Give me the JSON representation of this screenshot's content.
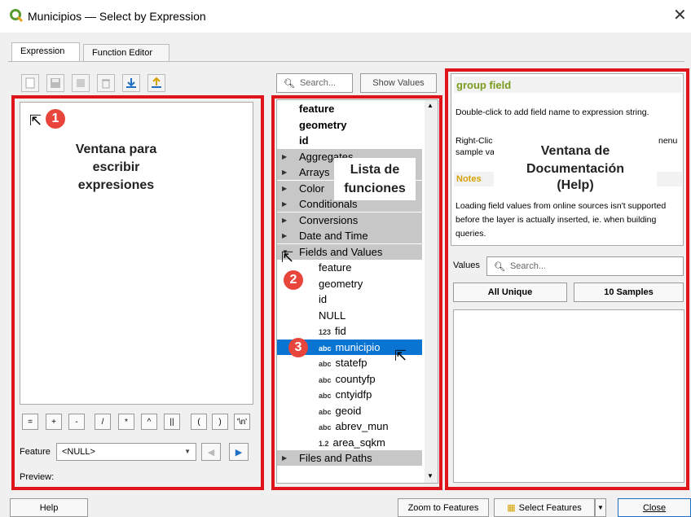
{
  "window": {
    "title": "Municipios — Select by Expression"
  },
  "tabs": [
    "Expression",
    "Function Editor"
  ],
  "search": {
    "placeholder": "Search...",
    "show_values": "Show Values"
  },
  "tree_items": [
    {
      "label": "feature",
      "bold": true
    },
    {
      "label": "geometry",
      "bold": true
    },
    {
      "label": "id",
      "bold": true
    },
    {
      "label": "Aggregates",
      "group": true
    },
    {
      "label": "Arrays",
      "group": true
    },
    {
      "label": "Color",
      "group": true
    },
    {
      "label": "Conditionals",
      "group": true
    },
    {
      "label": "Conversions",
      "group": true
    },
    {
      "label": "Date and Time",
      "group": true
    },
    {
      "label": "Fields and Values",
      "group": true,
      "open": true
    },
    {
      "label": "feature",
      "child": true
    },
    {
      "label": "geometry",
      "child": true
    },
    {
      "label": "id",
      "child": true
    },
    {
      "label": "NULL",
      "child": true
    },
    {
      "label": "fid",
      "child": true,
      "type": "123"
    },
    {
      "label": "municipio",
      "child": true,
      "type": "abc",
      "selected": true
    },
    {
      "label": "statefp",
      "child": true,
      "type": "abc"
    },
    {
      "label": "countyfp",
      "child": true,
      "type": "abc"
    },
    {
      "label": "cntyidfp",
      "child": true,
      "type": "abc"
    },
    {
      "label": "geoid",
      "child": true,
      "type": "abc"
    },
    {
      "label": "abrev_mun",
      "child": true,
      "type": "abc"
    },
    {
      "label": "area_sqkm",
      "child": true,
      "type": "1.2"
    },
    {
      "label": "Files and Paths",
      "group": true
    }
  ],
  "operators": [
    "=",
    "+",
    "-",
    "/",
    "*",
    "^",
    "||",
    "(",
    ")",
    "'\\n'"
  ],
  "feature": {
    "label": "Feature",
    "value": "<NULL>"
  },
  "preview_label": "Preview:",
  "help": {
    "title": "group field",
    "line1": "Double-click to add field name to expression string.",
    "line2a": "Right-Clic",
    "line2b": "nenu",
    "line3": "sample va",
    "notes": "Notes",
    "body": "Loading field values from online sources isn't supported before the layer is actually inserted, ie. when building queries."
  },
  "values": {
    "label": "Values",
    "placeholder": "Search...",
    "all_unique": "All Unique",
    "samples": "10 Samples"
  },
  "overlay": {
    "badges": [
      "1",
      "2",
      "3"
    ],
    "left_text": [
      "Ventana para",
      "escribir",
      "expresiones"
    ],
    "mid_text": [
      "Lista de",
      "funciones"
    ],
    "right_text": [
      "Ventana de",
      "Documentación",
      "(Help)"
    ]
  },
  "buttons": {
    "help": "Help",
    "zoom": "Zoom to Features",
    "select": "Select Features",
    "close": "Close"
  },
  "colors": {
    "red_frame": "#e0141b",
    "selection": "#0a74d2",
    "help_title": "#7a9a1e"
  }
}
